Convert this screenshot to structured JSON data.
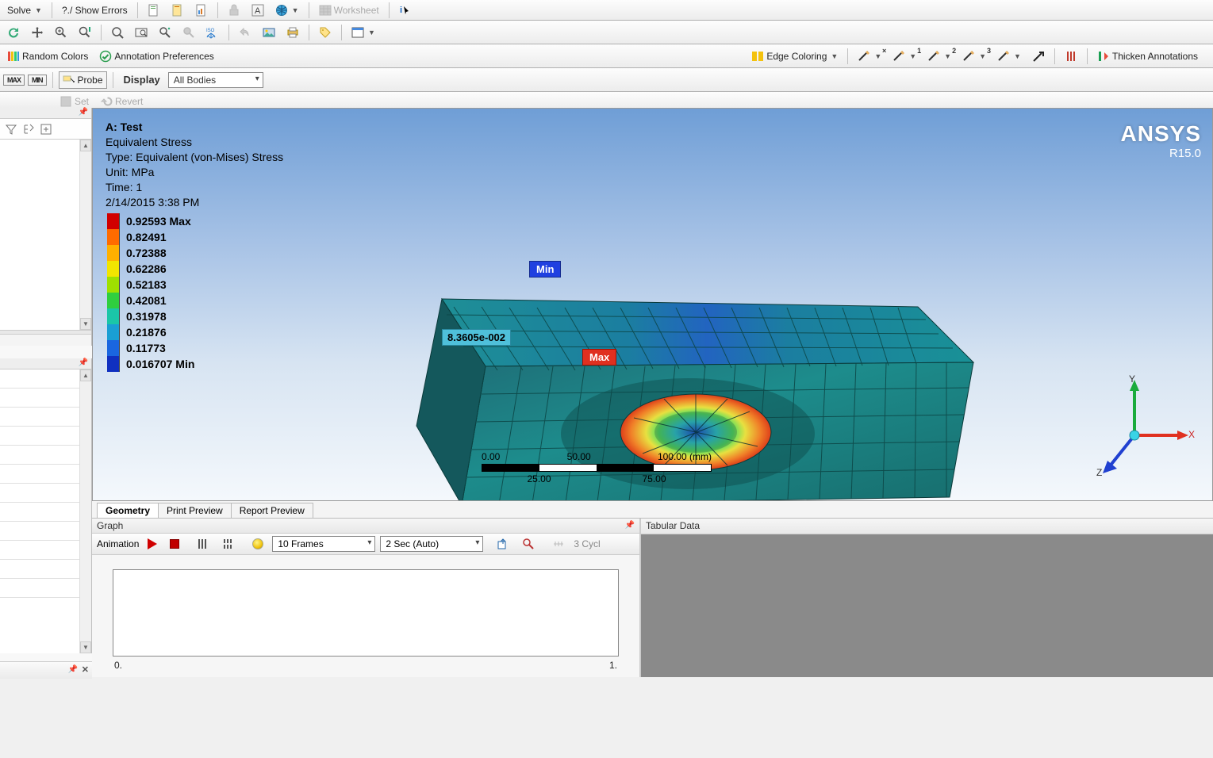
{
  "toolbar1": {
    "solve": "Solve",
    "showErrors": "?./ Show Errors",
    "worksheet": "Worksheet"
  },
  "toolbar3": {
    "randomColors": "Random Colors",
    "annotationPrefs": "Annotation Preferences",
    "edgeColoring": "Edge Coloring",
    "thicken": "Thicken Annotations"
  },
  "toolbar4": {
    "probe": "Probe",
    "display": "Display",
    "bodiesCombo": "All Bodies"
  },
  "toolbar5": {
    "set": "Set",
    "revert": "Revert"
  },
  "viewport": {
    "info": {
      "title": "A: Test",
      "line2": "Equivalent Stress",
      "line3": "Type: Equivalent (von-Mises) Stress",
      "line4": "Unit: MPa",
      "line5": "Time: 1",
      "line6": "2/14/2015 3:38 PM"
    },
    "brand": {
      "name": "ANSYS",
      "ver": "R15.0"
    },
    "legend": [
      {
        "c": "#d10000",
        "v": "0.92593 Max"
      },
      {
        "c": "#ff6b00",
        "v": "0.82491"
      },
      {
        "c": "#ffb000",
        "v": "0.72388"
      },
      {
        "c": "#f2e500",
        "v": "0.62286"
      },
      {
        "c": "#9fe000",
        "v": "0.52183"
      },
      {
        "c": "#2fcf3f",
        "v": "0.42081"
      },
      {
        "c": "#1bc6a8",
        "v": "0.31978"
      },
      {
        "c": "#1a9fd4",
        "v": "0.21876"
      },
      {
        "c": "#1a66e0",
        "v": "0.11773"
      },
      {
        "c": "#1030c0",
        "v": "0.016707 Min"
      }
    ],
    "probeValue": "8.3605e-002",
    "minLabel": "Min",
    "maxLabel": "Max",
    "scale": {
      "t0": "0.00",
      "t1": "50.00",
      "t2": "100.00 (mm)",
      "b0": "25.00",
      "b1": "75.00"
    },
    "triad": {
      "x": "X",
      "y": "Y",
      "z": "Z"
    }
  },
  "viewtabs": {
    "geometry": "Geometry",
    "printPreview": "Print Preview",
    "reportPreview": "Report Preview"
  },
  "graph": {
    "title": "Graph",
    "animation": "Animation",
    "framesCombo": "10 Frames",
    "timeCombo": "2 Sec (Auto)",
    "cycles": "3 Cycl",
    "axis0": "0.",
    "axis1": "1."
  },
  "tabular": {
    "title": "Tabular Data"
  }
}
